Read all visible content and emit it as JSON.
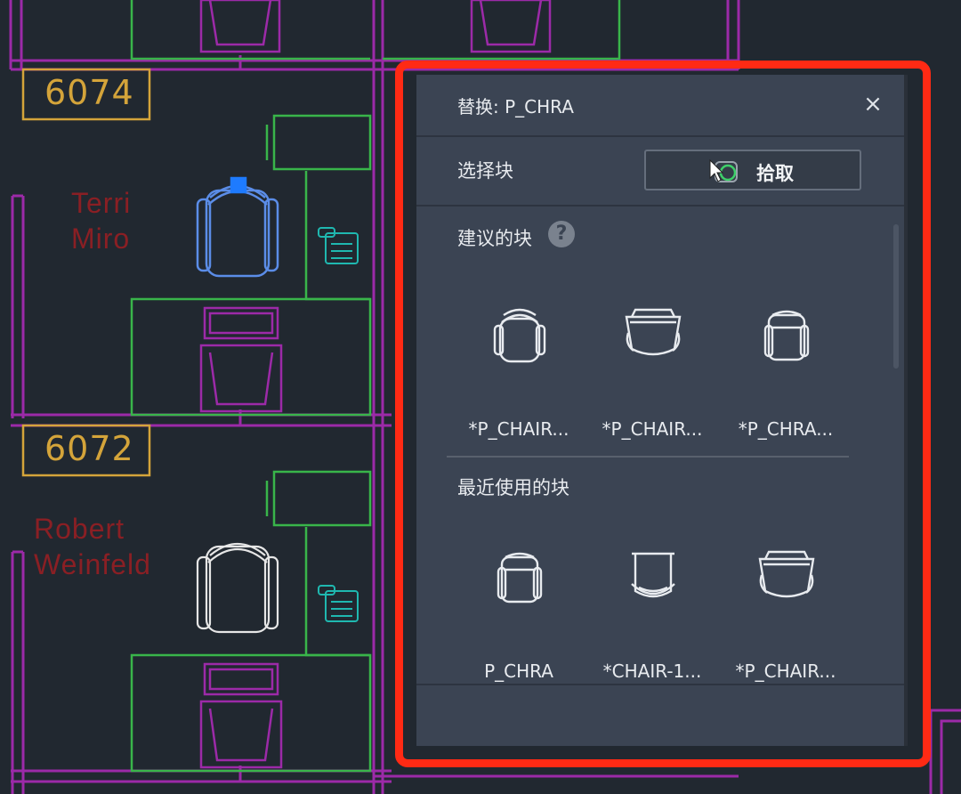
{
  "drawing": {
    "rooms": [
      {
        "number": "6074",
        "occupant": "Terri\nMiro"
      },
      {
        "number": "6072",
        "occupant": "Robert\nWeinfeld"
      }
    ]
  },
  "panel": {
    "title": "替换: P_CHRA",
    "close_icon": "close-icon",
    "select_block_label": "选择块",
    "pick_button_label": "拾取",
    "pick_icon": "pick-point-icon",
    "suggested_heading": "建议的块",
    "help_icon_glyph": "?",
    "suggested_blocks": [
      {
        "name": "*P_CHAIR...",
        "icon": "chair-round-icon"
      },
      {
        "name": "*P_CHAIR...",
        "icon": "chair-wide-icon"
      },
      {
        "name": "*P_CHRA...",
        "icon": "chair-square-icon"
      }
    ],
    "recent_heading": "最近使用的块",
    "recent_blocks": [
      {
        "name": "P_CHRA",
        "icon": "chair-square-icon"
      },
      {
        "name": "*CHAIR-1...",
        "icon": "chair-cup-icon"
      },
      {
        "name": "*P_CHAIR...",
        "icon": "chair-wide-icon"
      }
    ]
  },
  "colors": {
    "highlight": "#ff2a14",
    "panel_bg": "#3b4453",
    "canvas_bg": "#212830",
    "wall_magenta": "#9c2aa8",
    "desk_green": "#39b54a",
    "room_tag_gold": "#d4a43a",
    "occupant_red": "#8a1f24",
    "selected_chair_blue": "#5b8de8",
    "phone_cyan": "#1fb8b0"
  }
}
